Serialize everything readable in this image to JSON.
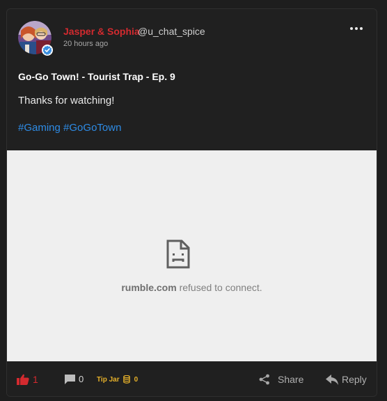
{
  "post": {
    "author": {
      "display_name": "Jasper & Sophia",
      "handle": "@u_chat_spice",
      "verified": true,
      "avatar_icon": "avatar-photo"
    },
    "timestamp": "20 hours ago",
    "title": "Go-Go Town! - Tourist Trap - Ep. 9",
    "body": "Thanks for watching!",
    "hashtags": [
      "#Gaming",
      "#GoGoTown"
    ],
    "menu_icon": "more-dots-icon"
  },
  "embed": {
    "error_icon": "sad-page-icon",
    "error_domain": "rumble.com",
    "error_message": " refused to connect."
  },
  "footer": {
    "like_count": "1",
    "comment_count": "0",
    "tip_label": "Tip Jar",
    "tip_count": "0",
    "share_label": "Share",
    "reply_label": "Reply"
  },
  "colors": {
    "display_name": "#d32a2f",
    "hashtag": "#2e8ce6",
    "tip": "#e6b12a",
    "verified": "#3a8fe0"
  }
}
